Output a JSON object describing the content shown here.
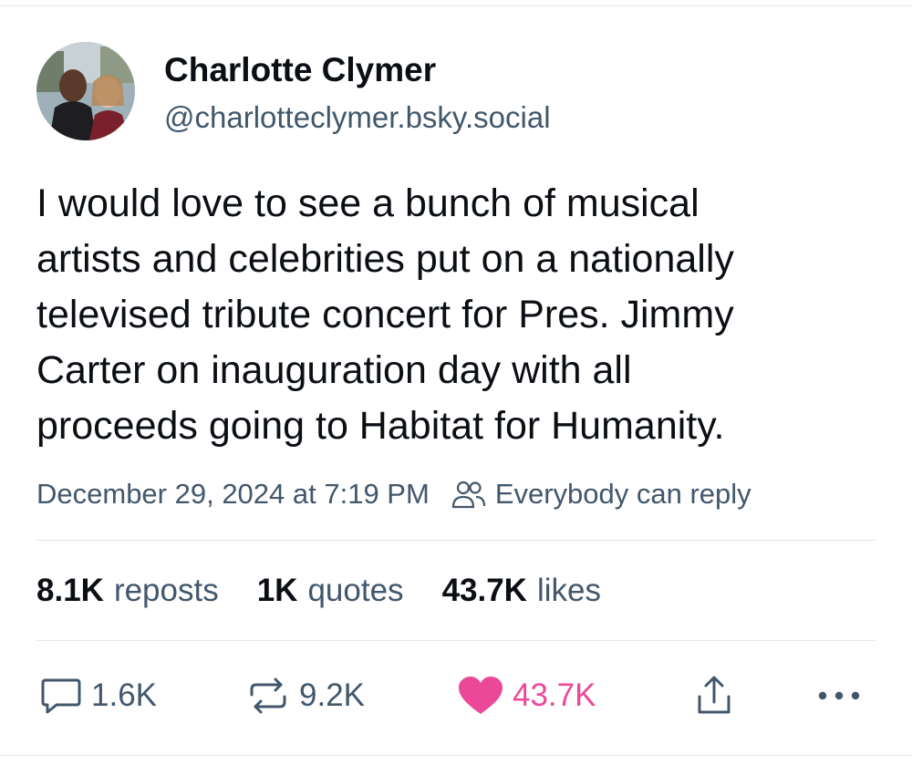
{
  "author": {
    "display_name": "Charlotte Clymer",
    "handle": "@charlotteclymer.bsky.social",
    "avatar_icon": "profile-photo"
  },
  "post": {
    "text_lines": [
      "I would love to see a bunch of musical",
      "artists and celebrities put on a nationally",
      "televised tribute concert for Pres. Jimmy",
      "Carter on inauguration day with all",
      "proceeds going to Habitat for Humanity."
    ],
    "timestamp": "December 29, 2024 at 7:19 PM",
    "reply_setting": "Everybody can reply",
    "reply_setting_icon": "people-icon"
  },
  "stats": {
    "reposts_count": "8.1K",
    "reposts_label": "reposts",
    "quotes_count": "1K",
    "quotes_label": "quotes",
    "likes_count": "43.7K",
    "likes_label": "likes"
  },
  "actions": {
    "reply_count": "1.6K",
    "repost_count": "9.2K",
    "like_count": "43.7K",
    "reply_icon": "speech-bubble-icon",
    "repost_icon": "repost-arrows-icon",
    "like_icon": "heart-icon",
    "share_icon": "share-icon",
    "more_icon": "more-icon"
  },
  "colors": {
    "text": "#0b0f14",
    "muted": "#42576c",
    "like_accent": "#ec4899",
    "divider": "#e3e7eb"
  }
}
